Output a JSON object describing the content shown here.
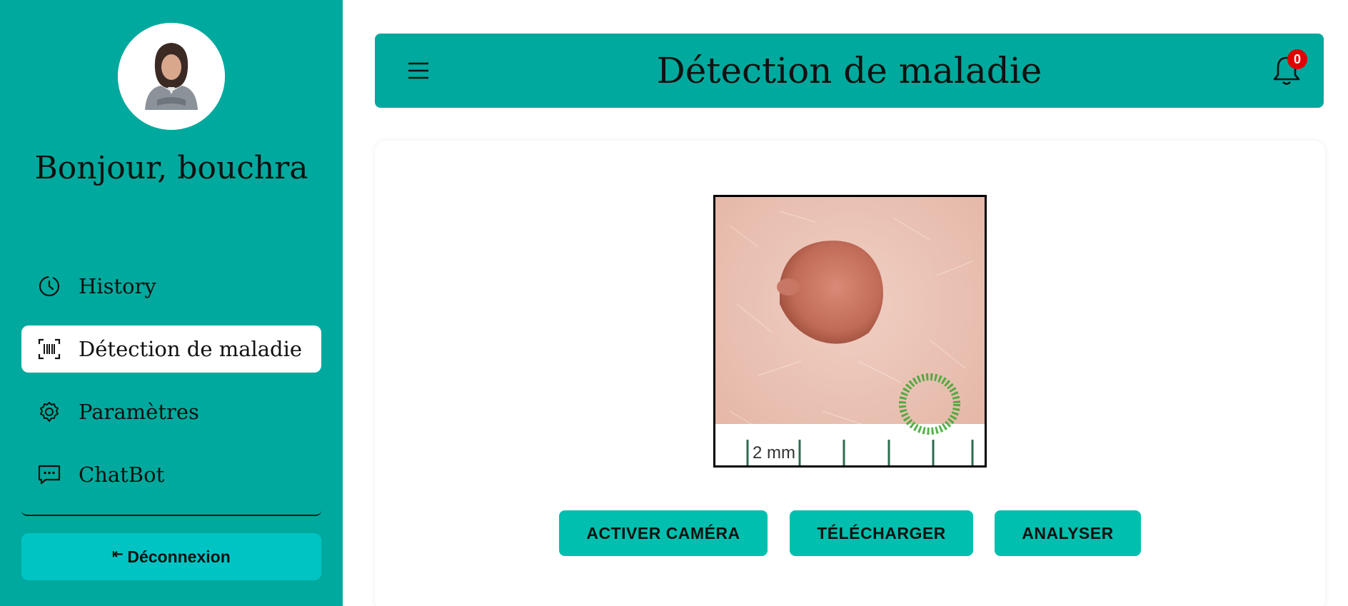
{
  "sidebar": {
    "greeting": "Bonjour, bouchra",
    "items": [
      {
        "label": "History",
        "icon": "history-icon"
      },
      {
        "label": "Détection de maladie",
        "icon": "barcode-scan-icon"
      },
      {
        "label": "Paramètres",
        "icon": "gear-icon"
      },
      {
        "label": "ChatBot",
        "icon": "chat-icon"
      }
    ],
    "active_index": 1,
    "logout_icon": "⇤",
    "logout_label": "Déconnexion"
  },
  "header": {
    "title": "Détection de maladie",
    "notification_count": "0"
  },
  "main": {
    "preview_scale_label": "2 mm",
    "buttons": {
      "camera": "ACTIVER CAMÉRA",
      "upload": "TÉLÉCHARGER",
      "analyze": "ANALYSER"
    }
  },
  "colors": {
    "primary": "#00a99d",
    "button": "#00bfae",
    "logout": "#00c4c4",
    "badge": "#e00000"
  }
}
